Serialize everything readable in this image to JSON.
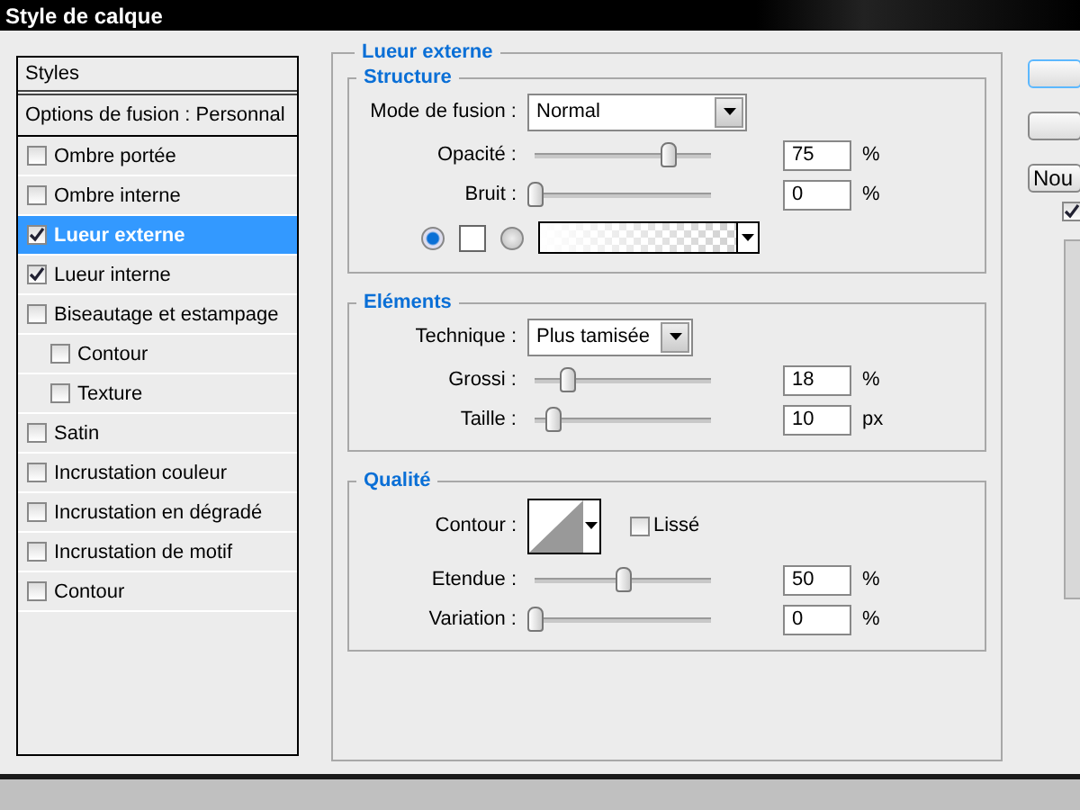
{
  "window": {
    "title": "Style de calque"
  },
  "styles_panel": {
    "header": "Styles",
    "blend_options": "Options de fusion : Personnal",
    "items": [
      {
        "label": "Ombre portée",
        "checked": false,
        "selected": false
      },
      {
        "label": "Ombre interne",
        "checked": false,
        "selected": false
      },
      {
        "label": "Lueur externe",
        "checked": true,
        "selected": true
      },
      {
        "label": "Lueur interne",
        "checked": true,
        "selected": false
      },
      {
        "label": "Biseautage et estampage",
        "checked": false,
        "selected": false,
        "children": [
          {
            "label": "Contour",
            "checked": false,
            "selected": false
          },
          {
            "label": "Texture",
            "checked": false,
            "selected": false
          }
        ]
      },
      {
        "label": "Satin",
        "checked": false,
        "selected": false
      },
      {
        "label": "Incrustation couleur",
        "checked": false,
        "selected": false
      },
      {
        "label": "Incrustation en dégradé",
        "checked": false,
        "selected": false
      },
      {
        "label": "Incrustation de motif",
        "checked": false,
        "selected": false
      },
      {
        "label": "Contour",
        "checked": false,
        "selected": false
      }
    ]
  },
  "settings": {
    "title": "Lueur externe",
    "groups": [
      {
        "title": "Structure",
        "rows": [
          {
            "kind": "dropdown",
            "label": "Mode de fusion :",
            "value": "Normal"
          },
          {
            "kind": "slider",
            "label": "Opacité :",
            "level": 0.75,
            "value": "75",
            "unit": "%"
          },
          {
            "kind": "slider",
            "label": "Bruit :",
            "level": 0,
            "value": "0",
            "unit": "%"
          },
          {
            "kind": "fill",
            "options": [
              {
                "kind": "color",
                "selected": true
              },
              {
                "kind": "gradient",
                "selected": false
              }
            ]
          }
        ]
      },
      {
        "title": "Eléments",
        "rows": [
          {
            "kind": "dropdown",
            "label": "Technique :",
            "value": "Plus tamisée"
          },
          {
            "kind": "slider",
            "label": "Grossi :",
            "level": 0.18,
            "value": "18",
            "unit": "%"
          },
          {
            "kind": "slider",
            "label": "Taille :",
            "level": 0.1,
            "value": "10",
            "unit": "px"
          }
        ]
      },
      {
        "title": "Qualité",
        "rows": [
          {
            "kind": "contour",
            "label": "Contour :",
            "check_label": "Lissé",
            "checked": false
          },
          {
            "kind": "slider",
            "label": "Etendue :",
            "level": 0.5,
            "value": "50",
            "unit": "%"
          },
          {
            "kind": "slider",
            "label": "Variation :",
            "level": 0,
            "value": "0",
            "unit": "%"
          }
        ]
      }
    ]
  },
  "new_button": {
    "label": "Nou"
  },
  "preview": {
    "checked": true
  }
}
